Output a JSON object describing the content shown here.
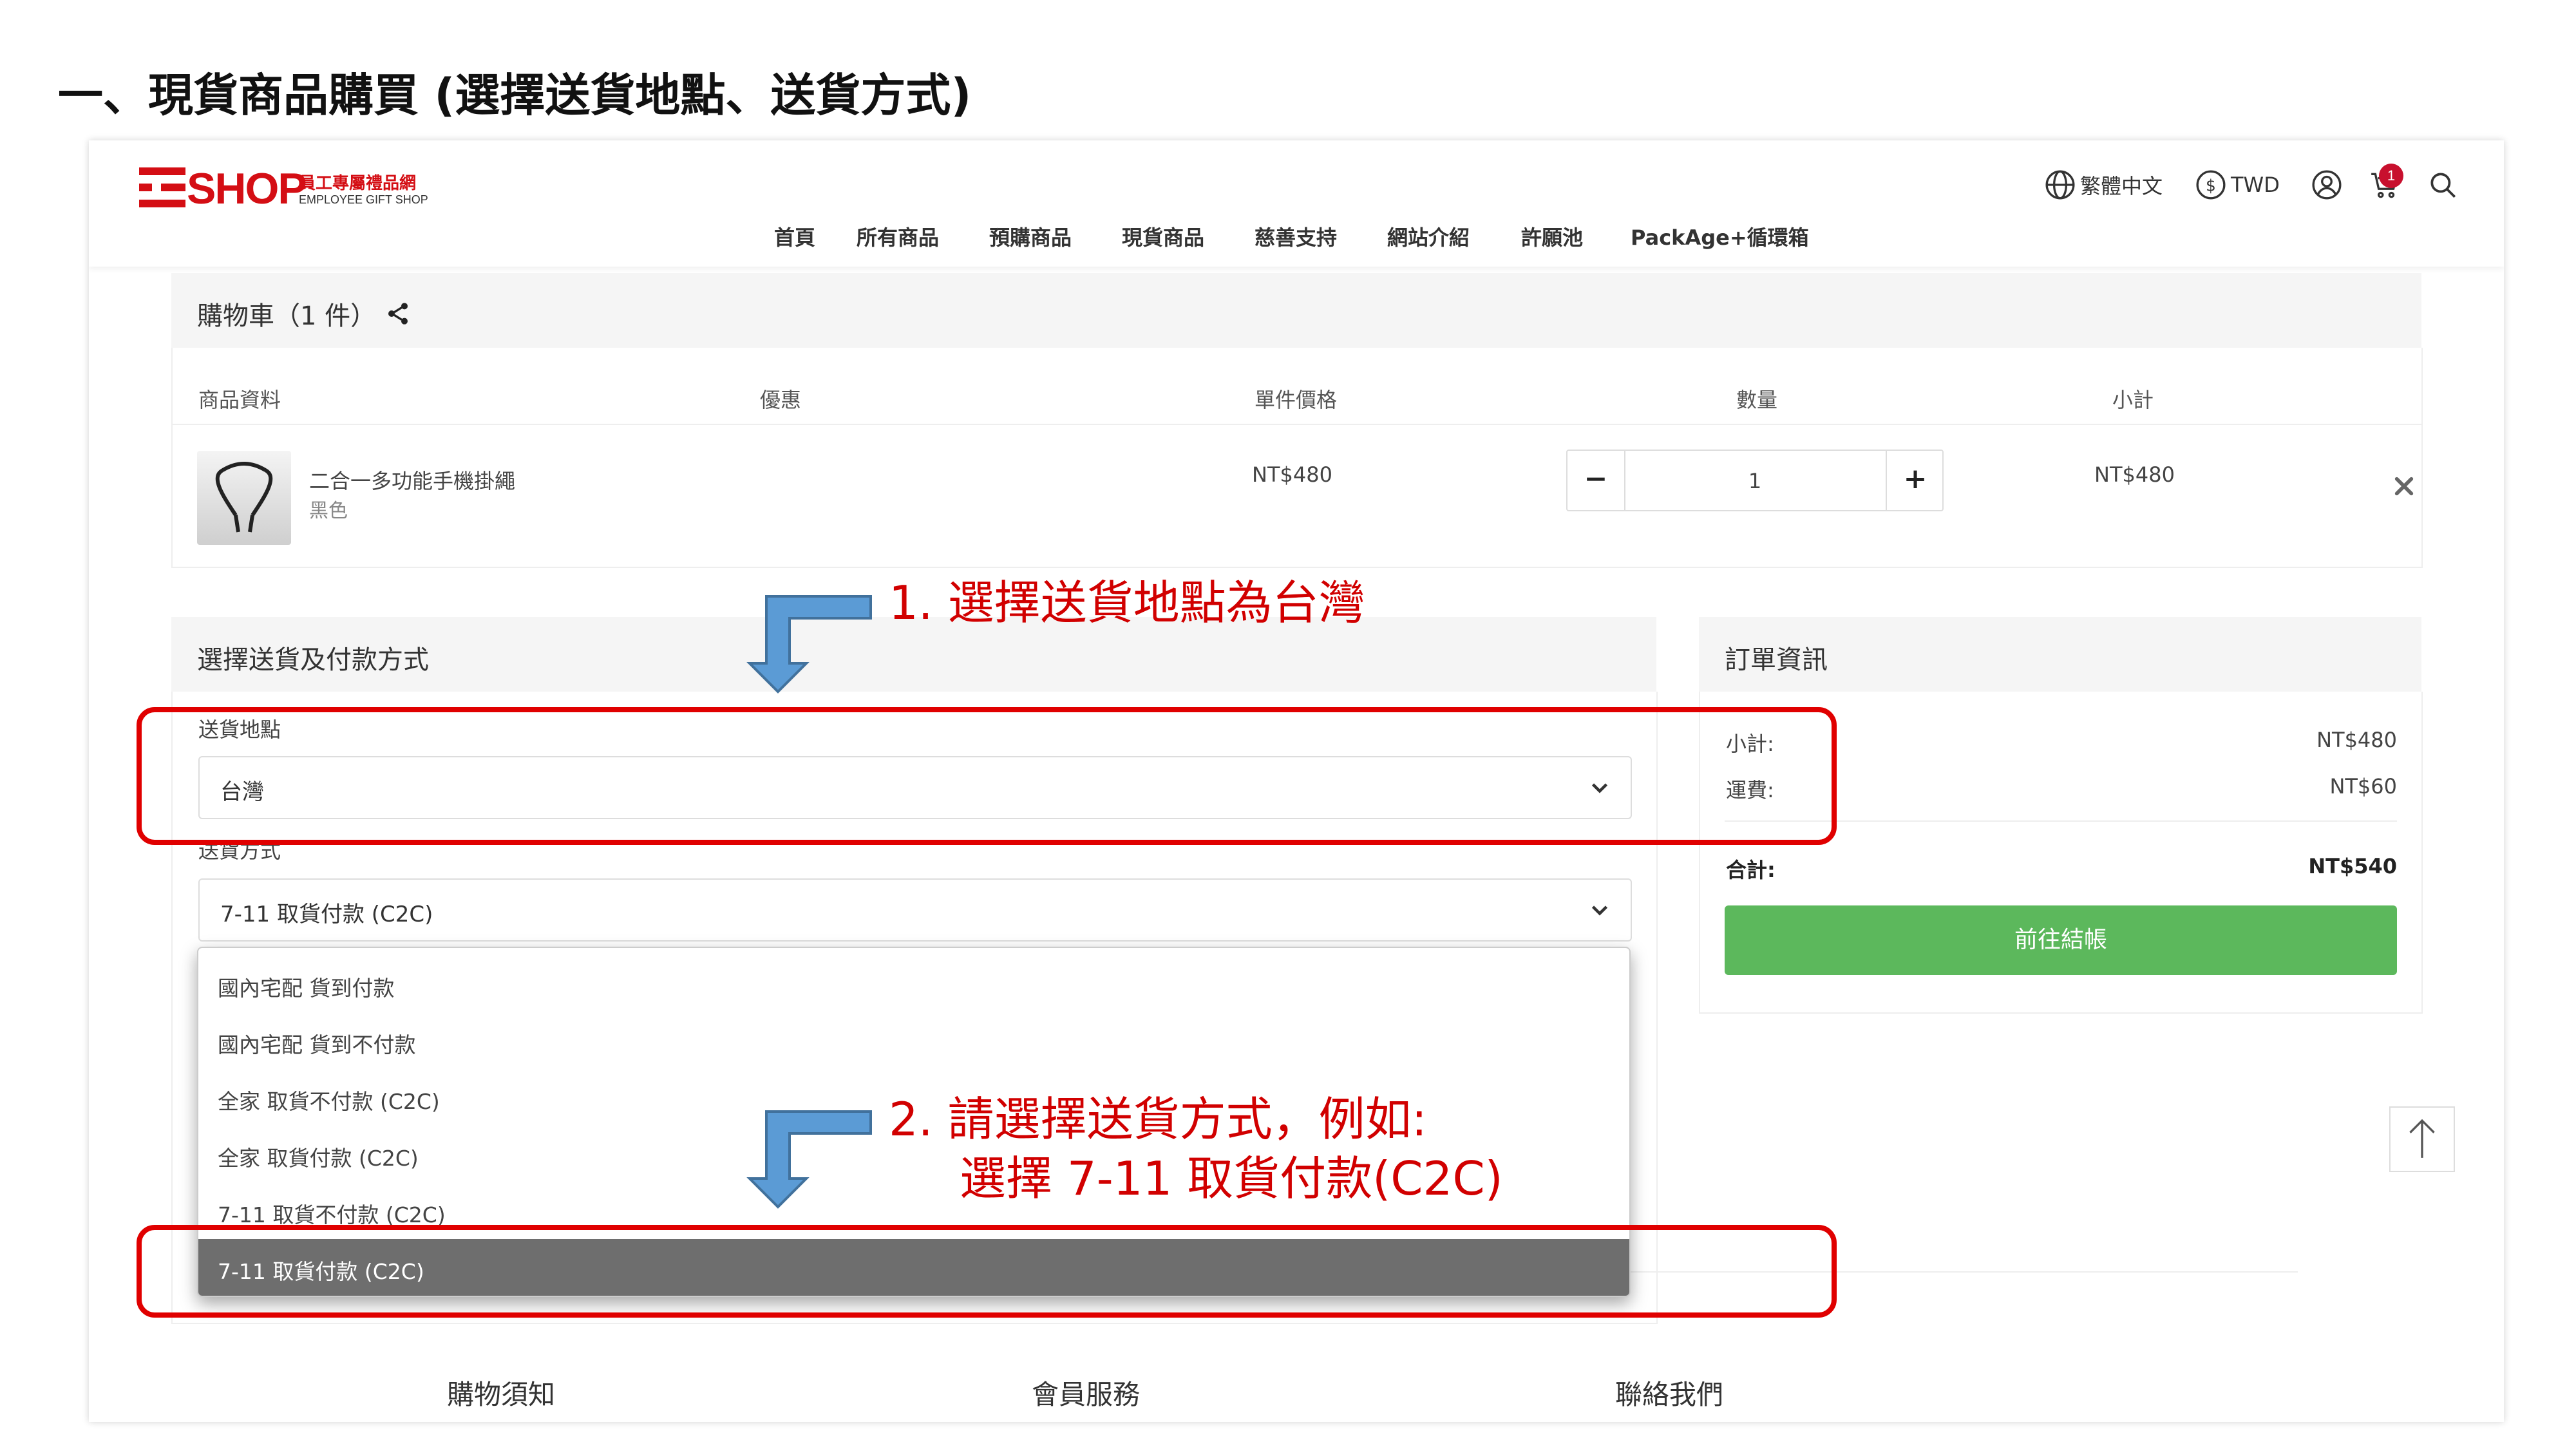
{
  "heading": "一、現貨商品購買 (選擇送貨地點、送貨方式)",
  "logo": {
    "mark": "SHOP",
    "cn": "員工專屬禮品網",
    "en": "EMPLOYEE GIFT SHOP"
  },
  "nav": [
    "首頁",
    "所有商品",
    "預購商品",
    "現貨商品",
    "慈善支持",
    "網站介紹",
    "許願池",
    "PackAge+循環箱"
  ],
  "header_tools": {
    "language": "繁體中文",
    "currency": "TWD",
    "cart_count": "1"
  },
  "cart": {
    "title": "購物車（1 件）",
    "columns": [
      "商品資料",
      "優惠",
      "單件價格",
      "數量",
      "小計"
    ],
    "item": {
      "name": "二合一多功能手機掛繩",
      "variant": "黑色",
      "price": "NT$480",
      "quantity": "1",
      "subtotal": "NT$480"
    },
    "qty_minus": "−",
    "qty_plus": "+"
  },
  "shipping": {
    "title": "選擇送貨及付款方式",
    "location_label": "送貨地點",
    "location_value": "台灣",
    "method_label": "送貨方式",
    "method_value": "7-11 取貨付款 (C2C)",
    "options": [
      "國內宅配 貨到付款",
      "國內宅配 貨到不付款",
      "全家 取貨不付款 (C2C)",
      "全家 取貨付款 (C2C)",
      "7-11 取貨不付款 (C2C)",
      "7-11 取貨付款 (C2C)"
    ],
    "selected_index": 5
  },
  "order": {
    "title": "訂單資訊",
    "subtotal_label": "小計:",
    "subtotal_value": "NT$480",
    "shipping_label": "運費:",
    "shipping_value": "NT$60",
    "total_label": "合計:",
    "total_value": "NT$540",
    "checkout_label": "前往結帳"
  },
  "footer": [
    "購物須知",
    "會員服務",
    "聯絡我們"
  ],
  "annotations": {
    "step1": "1.  選擇送貨地點為台灣",
    "step2_line1": "2.  請選擇送貨方式，例如:",
    "step2_line2": "選擇 7-11 取貨付款(C2C)"
  },
  "colors": {
    "brand": "#d40e14",
    "checkout": "#5cb85c",
    "annotation": "#e00000",
    "arrow": "#5b9bd5"
  }
}
